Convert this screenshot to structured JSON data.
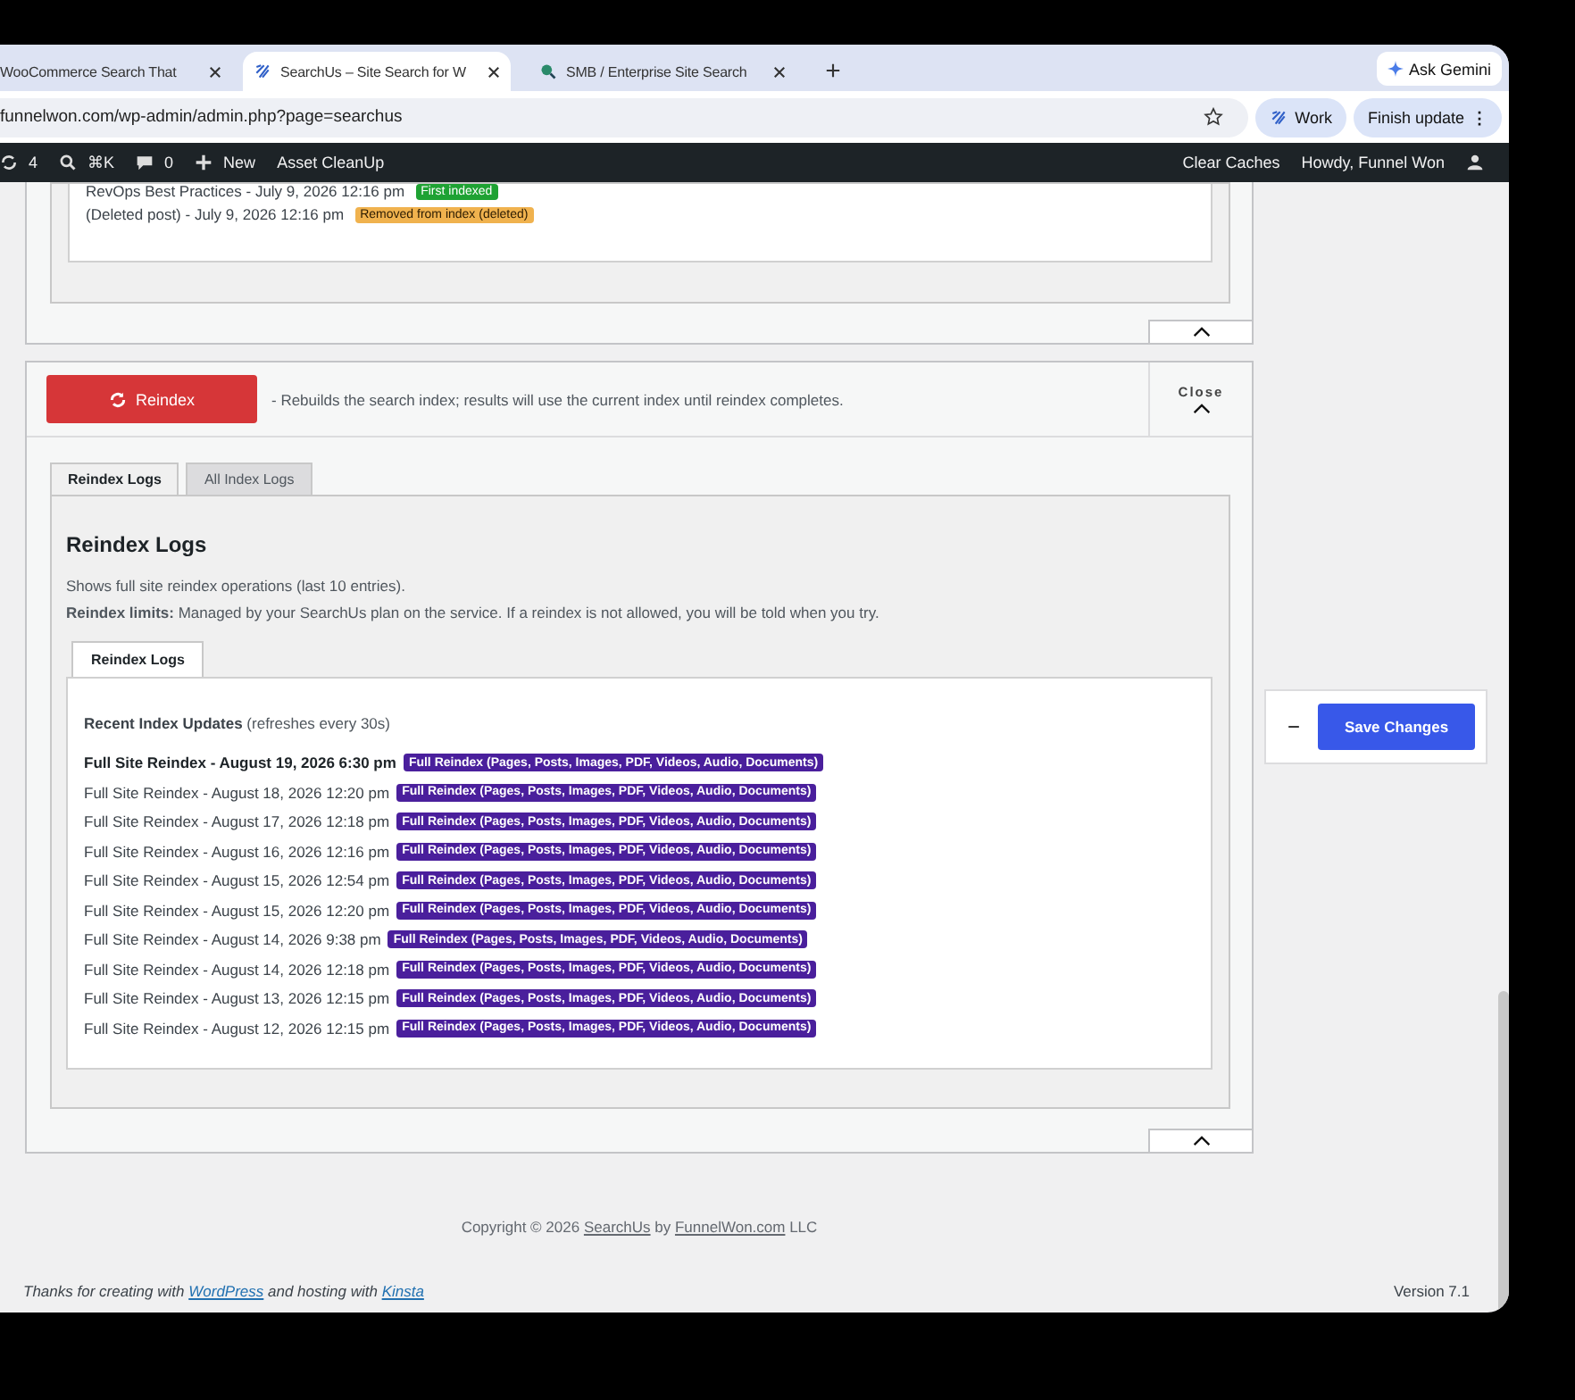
{
  "browser": {
    "tabs": [
      {
        "title": "WooCommerce Search That",
        "selected": false
      },
      {
        "title": "SearchUs – Site Search for W",
        "selected": true
      },
      {
        "title": "SMB / Enterprise Site Search",
        "selected": false
      }
    ],
    "menu": "⋮",
    "ask": "Ask Gemini",
    "url": "funnelwon.com/wp-admin/admin.php?page=searchus",
    "profile": "Work",
    "update": "Finish update"
  },
  "admin_bar": {
    "updates": "4",
    "shortcut": "⌘K",
    "comments": "0",
    "new": "New",
    "asset": "Asset CleanUp",
    "clear": "Clear Caches",
    "howdy": "Howdy, Funnel Won"
  },
  "recent_items": [
    {
      "text": "RevOps Best Practices - July 9, 2026 12:16 pm",
      "badge": "First indexed",
      "kind": "added"
    },
    {
      "text": "(Deleted post) - July 9, 2026 12:16 pm",
      "badge": "Removed from index (deleted)",
      "kind": "removed"
    }
  ],
  "reindex": {
    "button": "Reindex",
    "description": "- Rebuilds the search index; results will use the current index until reindex completes.",
    "close": "Close",
    "tabs": [
      {
        "label": "Reindex Logs",
        "selected": true
      },
      {
        "label": "All Index Logs",
        "selected": false
      }
    ],
    "heading": "Reindex Logs",
    "intro": "Shows full site reindex operations (last 10 entries).",
    "limits": "**Reindex limits:** Managed by your SearchUs plan on the service. If a reindex is not allowed, you will be told when you try.",
    "inner_tabs": [
      {
        "label": "Reindex Logs",
        "selected": true
      }
    ],
    "log_heading": "**Recent Index Updates** (refreshes every 30s)",
    "entries": [
      {
        "text": "Full Site Reindex - August 19, 2026 6:30 pm",
        "badge": "Full Reindex (Pages, Posts, Images, PDF, Videos, Audio, Documents)",
        "latest": true
      },
      {
        "text": "Full Site Reindex - August 18, 2026 12:20 pm",
        "badge": "Full Reindex (Pages, Posts, Images, PDF, Videos, Audio, Documents)",
        "latest": false
      },
      {
        "text": "Full Site Reindex - August 17, 2026 12:18 pm",
        "badge": "Full Reindex (Pages, Posts, Images, PDF, Videos, Audio, Documents)",
        "latest": false
      },
      {
        "text": "Full Site Reindex - August 16, 2026 12:16 pm",
        "badge": "Full Reindex (Pages, Posts, Images, PDF, Videos, Audio, Documents)",
        "latest": false
      },
      {
        "text": "Full Site Reindex - August 15, 2026 12:54 pm",
        "badge": "Full Reindex (Pages, Posts, Images, PDF, Videos, Audio, Documents)",
        "latest": false
      },
      {
        "text": "Full Site Reindex - August 15, 2026 12:20 pm",
        "badge": "Full Reindex (Pages, Posts, Images, PDF, Videos, Audio, Documents)",
        "latest": false
      },
      {
        "text": "Full Site Reindex - August 14, 2026 9:38 pm",
        "badge": "Full Reindex (Pages, Posts, Images, PDF, Videos, Audio, Documents)",
        "latest": false
      },
      {
        "text": "Full Site Reindex - August 14, 2026 12:18 pm",
        "badge": "Full Reindex (Pages, Posts, Images, PDF, Videos, Audio, Documents)",
        "latest": false
      },
      {
        "text": "Full Site Reindex - August 13, 2026 12:15 pm",
        "badge": "Full Reindex (Pages, Posts, Images, PDF, Videos, Audio, Documents)",
        "latest": false
      },
      {
        "text": "Full Site Reindex - August 12, 2026 12:15 pm",
        "badge": "Full Reindex (Pages, Posts, Images, PDF, Videos, Audio, Documents)",
        "latest": false
      }
    ]
  },
  "save": {
    "collapse": "−",
    "button": "Save Changes"
  },
  "footer": {
    "copyright": {
      "prefix": "Copyright © 2026",
      "link1": "SearchUs",
      "mid": "by",
      "link2": "FunnelWon.com",
      "suffix": "LLC"
    },
    "thanks": {
      "prefix": "Thanks for creating with",
      "link1": "WordPress",
      "mid": "and hosting with",
      "link2": "Kinsta"
    },
    "version": "Version 7.1"
  }
}
